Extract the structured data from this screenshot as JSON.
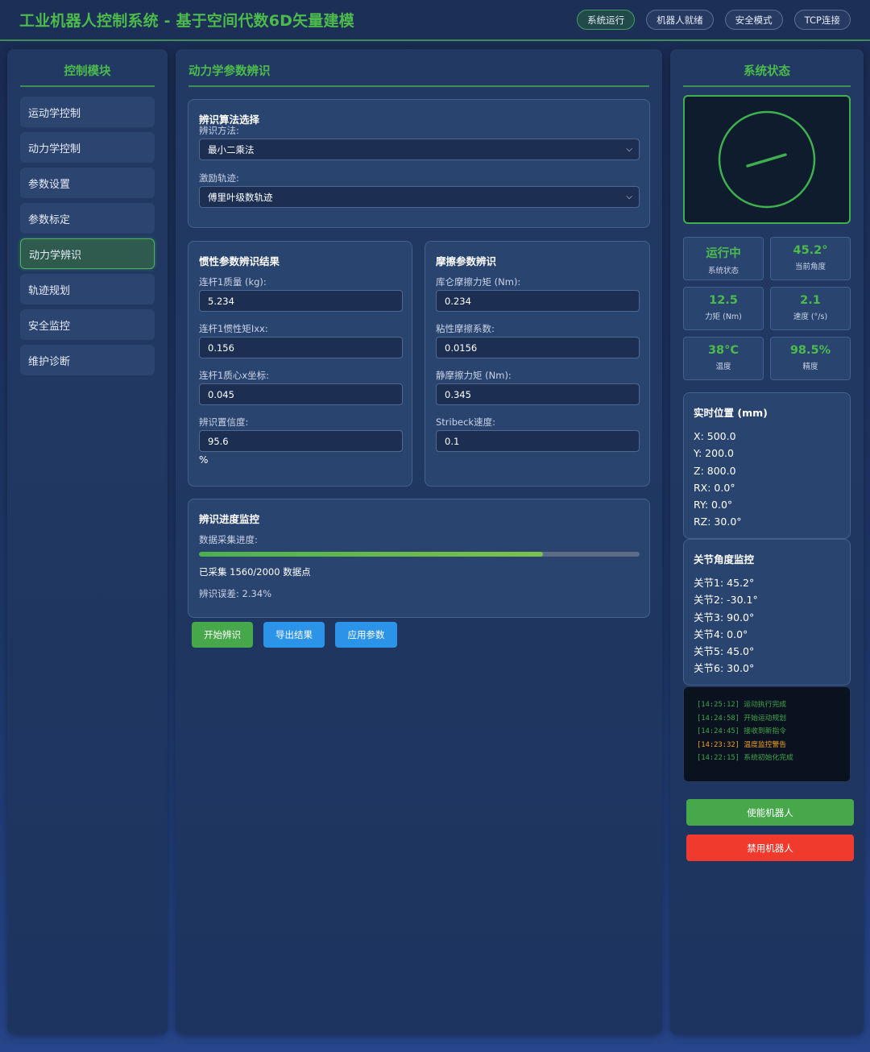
{
  "header": {
    "title": "工业机器人控制系统 - 基于空间代数6D矢量建模",
    "status_pills": [
      {
        "label": "系统运行",
        "active": true
      },
      {
        "label": "机器人就绪",
        "active": false
      },
      {
        "label": "安全模式",
        "active": false
      },
      {
        "label": "TCP连接",
        "active": false
      }
    ]
  },
  "sidebar": {
    "title": "控制模块",
    "items": [
      {
        "label": "运动学控制"
      },
      {
        "label": "动力学控制"
      },
      {
        "label": "参数设置"
      },
      {
        "label": "参数标定"
      },
      {
        "label": "动力学辨识",
        "active": true
      },
      {
        "label": "轨迹规划"
      },
      {
        "label": "安全监控"
      },
      {
        "label": "维护诊断"
      }
    ]
  },
  "main": {
    "title": "动力学参数辨识",
    "algorithm": {
      "title": "辨识算法选择",
      "method_label": "辨识方法:",
      "method_value": "最小二乘法",
      "trajectory_label": "激励轨迹:",
      "trajectory_value": "傅里叶级数轨迹"
    },
    "inertia": {
      "title": "惯性参数辨识结果",
      "fields": [
        {
          "label": "连杆1质量 (kg):",
          "value": "5.234"
        },
        {
          "label": "连杆1惯性矩Ixx:",
          "value": "0.156"
        },
        {
          "label": "连杆1质心x坐标:",
          "value": "0.045"
        },
        {
          "label": "辨识置信度:",
          "value": "95.6"
        }
      ],
      "confidence_unit": "%"
    },
    "friction": {
      "title": "摩擦参数辨识",
      "fields": [
        {
          "label": "库仑摩擦力矩 (Nm):",
          "value": "0.234"
        },
        {
          "label": "粘性摩擦系数:",
          "value": "0.0156"
        },
        {
          "label": "静摩擦力矩 (Nm):",
          "value": "0.345"
        },
        {
          "label": "Stribeck速度:",
          "value": "0.1"
        }
      ]
    },
    "progress": {
      "title": "辨识进度监控",
      "collect_label": "数据采集进度:",
      "collected": 1560,
      "total": 2000,
      "fraction": 0.78,
      "collected_text": "已采集 1560/2000 数据点",
      "error_text": "辨识误差: 2.34%"
    },
    "buttons": {
      "start": "开始辨识",
      "export": "导出结果",
      "apply": "应用参数"
    }
  },
  "status_panel": {
    "title": "系统状态",
    "stats": [
      {
        "value": "运行中",
        "label": "系统状态"
      },
      {
        "value": "45.2°",
        "label": "当前角度"
      },
      {
        "value": "12.5",
        "label": "力矩 (Nm)"
      },
      {
        "value": "2.1",
        "label": "速度 (°/s)"
      },
      {
        "value": "38°C",
        "label": "温度"
      },
      {
        "value": "98.5%",
        "label": "精度"
      }
    ],
    "position": {
      "title": "实时位置 (mm)",
      "lines": [
        "X: 500.0",
        "Y: 200.0",
        "Z: 800.0",
        "RX: 0.0°",
        "RY: 0.0°",
        "RZ: 30.0°"
      ]
    },
    "joints": {
      "title": "关节角度监控",
      "lines": [
        "关节1: 45.2°",
        "关节2: -30.1°",
        "关节3: 90.0°",
        "关节4: 0.0°",
        "关节5: 45.0°",
        "关节6: 30.0°"
      ]
    },
    "log": [
      {
        "time": "[14:25:12]",
        "msg": "运动执行完成",
        "level": "info"
      },
      {
        "time": "[14:24:58]",
        "msg": "开始运动规划",
        "level": "info"
      },
      {
        "time": "[14:24:45]",
        "msg": "接收到新指令",
        "level": "info"
      },
      {
        "time": "[14:23:32]",
        "msg": "温度监控警告",
        "level": "warn"
      },
      {
        "time": "[14:22:15]",
        "msg": "系统初始化完成",
        "level": "info"
      }
    ],
    "enable_button": "使能机器人",
    "disable_button": "禁用机器人"
  },
  "colors": {
    "accent_green": "#4cbb4c",
    "button_blue": "#2b93e8",
    "button_red": "#f03a2e",
    "warning_orange": "#f0a020"
  }
}
